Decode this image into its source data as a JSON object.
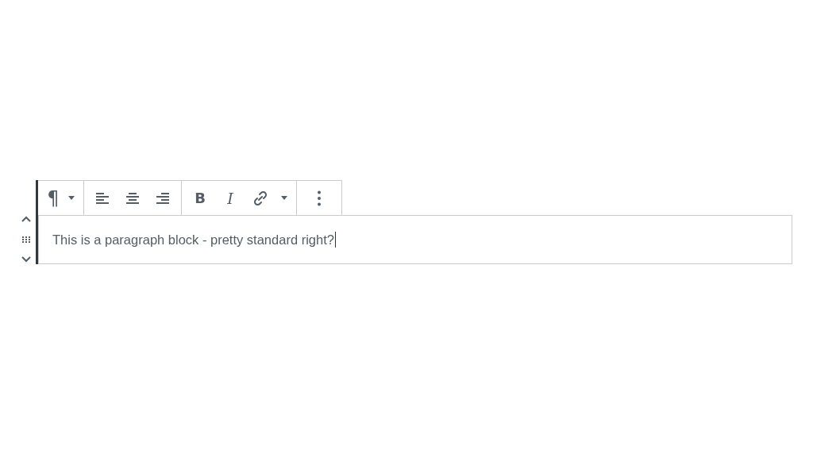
{
  "block_mover": [
    {
      "kind": "move-up"
    },
    {
      "kind": "drag"
    },
    {
      "kind": "move-down"
    }
  ],
  "toolbar": {
    "groups": [
      {
        "buttons": [
          {
            "kind": "glyph",
            "text": "¶"
          },
          {
            "kind": "caret"
          }
        ]
      },
      {
        "buttons": [
          {
            "kind": "align-left"
          },
          {
            "kind": "align-center"
          },
          {
            "kind": "align-right"
          }
        ]
      },
      {
        "buttons": [
          {
            "kind": "bold",
            "text": "B"
          },
          {
            "kind": "italic",
            "text": "I"
          },
          {
            "kind": "link"
          },
          {
            "kind": "caret"
          }
        ]
      },
      {
        "buttons": [
          {
            "kind": "more"
          }
        ]
      }
    ]
  },
  "paragraph": {
    "text": "This is a paragraph block - pretty standard right?",
    "caret": true
  }
}
